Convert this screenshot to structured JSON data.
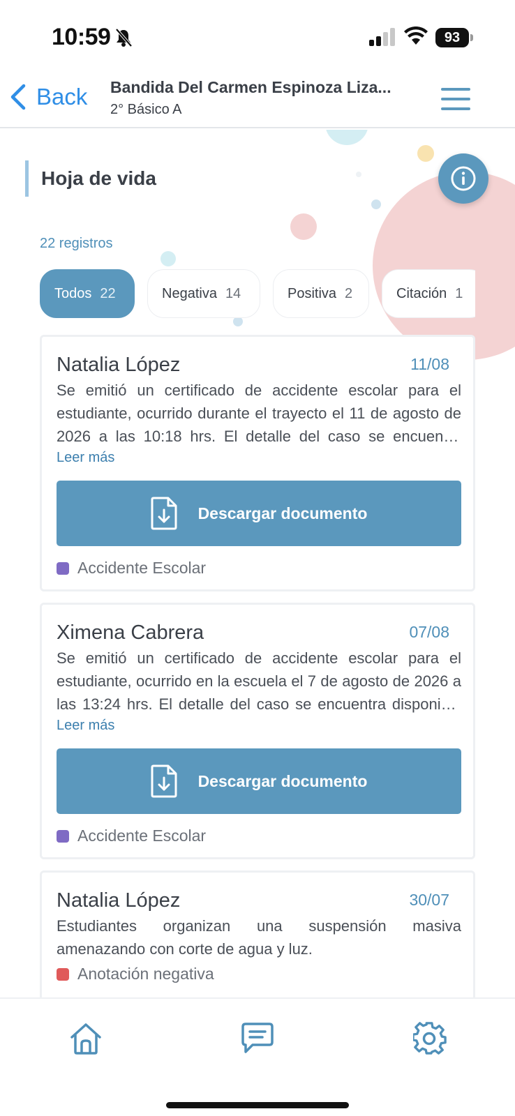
{
  "status_bar": {
    "time": "10:59",
    "battery": "93"
  },
  "header": {
    "back_label": "Back",
    "student_name": "Bandida Del Carmen Espinoza Liza...",
    "student_class": "2° Básico A"
  },
  "main": {
    "section_title": "Hoja de vida",
    "records_count": "22 registros",
    "filters": [
      {
        "label": "Todos",
        "count": "22",
        "active": true
      },
      {
        "label": "Negativa",
        "count": "14"
      },
      {
        "label": "Positiva",
        "count": "2"
      },
      {
        "label": "Citación",
        "count": "1"
      }
    ],
    "cards": [
      {
        "author": "Natalia López",
        "date": "11/08",
        "text": "Se emitió un certificado de accidente escolar para el estudiante, ocurrido durante el trayecto el 11 de agosto de 2026 a las 10:18 hrs. El detalle del caso se encuentra disponible en el documento adjunto.",
        "read_more": "Leer más",
        "download_label": "Descargar documento",
        "tag": "Accidente Escolar",
        "tag_color": "#7f6bc4"
      },
      {
        "author": "Ximena Cabrera",
        "date": "07/08",
        "text": "Se emitió un certificado de accidente escolar para el estudiante, ocurrido en la escuela el 7 de agosto de 2026 a las 13:24 hrs. El detalle del caso se encuentra disponible en el documento adjunto.",
        "read_more": "Leer más",
        "download_label": "Descargar documento",
        "tag": "Accidente Escolar",
        "tag_color": "#7f6bc4"
      },
      {
        "author": "Natalia López",
        "date": "30/07",
        "text": "Estudiantes organizan una suspensión masiva amenazando con corte de agua y luz.",
        "tag": "Anotación negativa",
        "tag_color": "#e05a5a"
      }
    ]
  },
  "nav": {
    "items": [
      {
        "icon": "home-icon"
      },
      {
        "icon": "chat-icon"
      },
      {
        "icon": "gear-icon"
      }
    ]
  },
  "colors": {
    "accent": "#5b98bd",
    "link": "#2f8ee6",
    "date": "#4f8fb8"
  }
}
